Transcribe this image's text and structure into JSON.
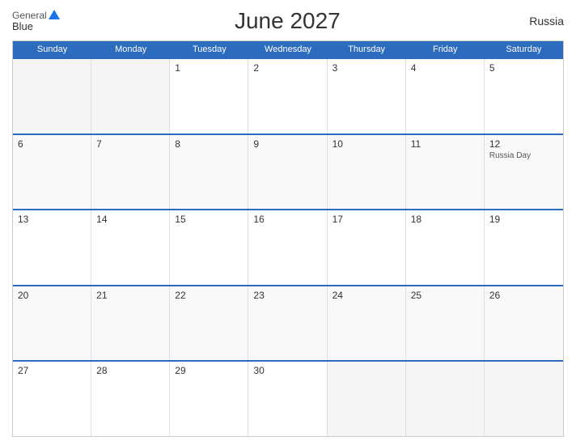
{
  "header": {
    "logo_general": "General",
    "logo_blue": "Blue",
    "title": "June 2027",
    "country": "Russia"
  },
  "calendar": {
    "days_of_week": [
      "Sunday",
      "Monday",
      "Tuesday",
      "Wednesday",
      "Thursday",
      "Friday",
      "Saturday"
    ],
    "weeks": [
      [
        {
          "num": "",
          "empty": true
        },
        {
          "num": "",
          "empty": true
        },
        {
          "num": "1",
          "empty": false
        },
        {
          "num": "2",
          "empty": false
        },
        {
          "num": "3",
          "empty": false
        },
        {
          "num": "4",
          "empty": false
        },
        {
          "num": "5",
          "empty": false
        }
      ],
      [
        {
          "num": "6",
          "empty": false
        },
        {
          "num": "7",
          "empty": false
        },
        {
          "num": "8",
          "empty": false
        },
        {
          "num": "9",
          "empty": false
        },
        {
          "num": "10",
          "empty": false
        },
        {
          "num": "11",
          "empty": false
        },
        {
          "num": "12",
          "empty": false,
          "holiday": "Russia Day"
        }
      ],
      [
        {
          "num": "13",
          "empty": false
        },
        {
          "num": "14",
          "empty": false
        },
        {
          "num": "15",
          "empty": false
        },
        {
          "num": "16",
          "empty": false
        },
        {
          "num": "17",
          "empty": false
        },
        {
          "num": "18",
          "empty": false
        },
        {
          "num": "19",
          "empty": false
        }
      ],
      [
        {
          "num": "20",
          "empty": false
        },
        {
          "num": "21",
          "empty": false
        },
        {
          "num": "22",
          "empty": false
        },
        {
          "num": "23",
          "empty": false
        },
        {
          "num": "24",
          "empty": false
        },
        {
          "num": "25",
          "empty": false
        },
        {
          "num": "26",
          "empty": false
        }
      ],
      [
        {
          "num": "27",
          "empty": false
        },
        {
          "num": "28",
          "empty": false
        },
        {
          "num": "29",
          "empty": false
        },
        {
          "num": "30",
          "empty": false
        },
        {
          "num": "",
          "empty": true
        },
        {
          "num": "",
          "empty": true
        },
        {
          "num": "",
          "empty": true
        }
      ]
    ]
  }
}
